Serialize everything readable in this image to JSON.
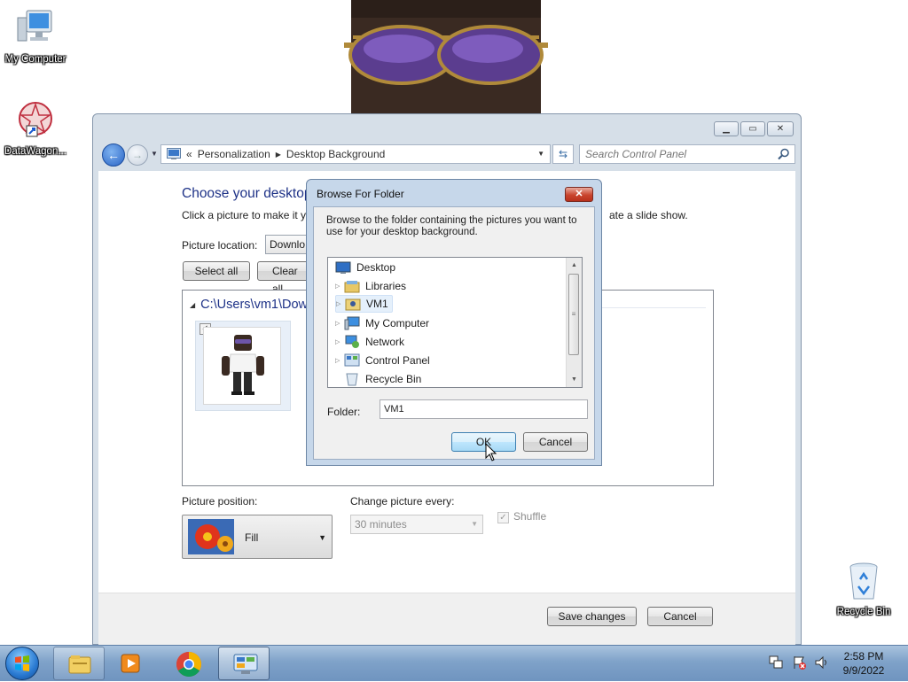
{
  "desktop": {
    "icons": [
      {
        "label": "My Computer"
      },
      {
        "label": "DataWagon..."
      },
      {
        "label": "Recycle Bin"
      }
    ]
  },
  "window": {
    "address": {
      "overflow": "«",
      "crumbs": [
        "Personalization",
        "Desktop Background"
      ]
    },
    "search_placeholder": "Search Control Panel",
    "heading": "Choose your desktop",
    "description": "Click a picture to make it y",
    "description_tail": "ate a slide show.",
    "picture_location_label": "Picture location:",
    "picture_location_value": "Downlo",
    "select_all": "Select all",
    "clear_all": "Clear all",
    "folder_path": "C:\\Users\\vm1\\Dow",
    "picture_position_label": "Picture position:",
    "picture_position_value": "Fill",
    "change_every_label": "Change picture every:",
    "change_every_value": "30 minutes",
    "shuffle_label": "Shuffle",
    "save_changes": "Save changes",
    "cancel": "Cancel"
  },
  "dialog": {
    "title": "Browse For Folder",
    "close_glyph": "✕",
    "description": "Browse to the folder containing the pictures you want to use for your desktop background.",
    "tree": [
      {
        "label": "Desktop",
        "icon": "desktop-icon"
      },
      {
        "label": "Libraries",
        "icon": "libraries-icon"
      },
      {
        "label": "VM1",
        "icon": "user-folder-icon",
        "selected": true
      },
      {
        "label": "My Computer",
        "icon": "computer-icon"
      },
      {
        "label": "Network",
        "icon": "network-icon"
      },
      {
        "label": "Control Panel",
        "icon": "control-panel-icon"
      },
      {
        "label": "Recycle Bin",
        "icon": "recycle-bin-icon"
      }
    ],
    "folder_label": "Folder:",
    "folder_value": "VM1",
    "ok": "OK",
    "cancel": "Cancel"
  },
  "taskbar": {
    "clock_time": "2:58 PM",
    "clock_date": "9/9/2022"
  }
}
